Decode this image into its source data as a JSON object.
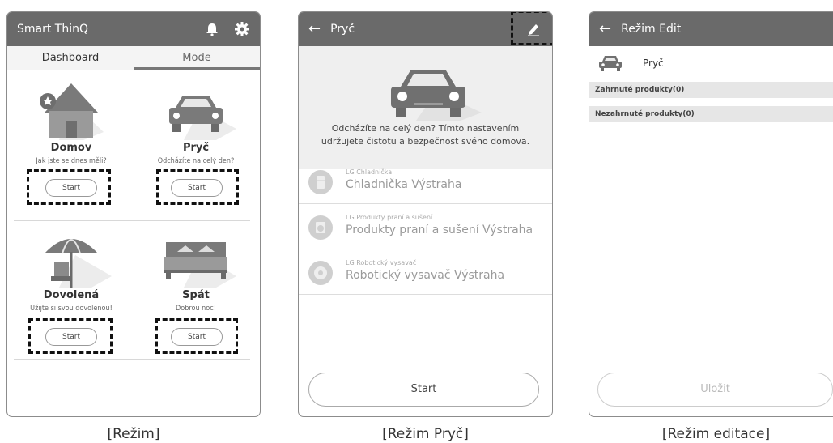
{
  "panel1": {
    "app_title": "Smart ThinQ",
    "tabs": [
      "Dashboard",
      "Mode"
    ],
    "cards": [
      {
        "name": "Domov",
        "subtitle": "Jak jste se dnes měli?",
        "button": "Start"
      },
      {
        "name": "Pryč",
        "subtitle": "Odcházíte na celý den?",
        "button": "Start"
      },
      {
        "name": "Dovolená",
        "subtitle": "Užijte si svou dovolenou!",
        "button": "Start"
      },
      {
        "name": "Spát",
        "subtitle": "Dobrou noc!",
        "button": "Start"
      }
    ],
    "caption": "[Režim]"
  },
  "panel2": {
    "title": "Pryč",
    "description_line1": "Odcházíte na celý den? Tímto nastavením",
    "description_line2": "udržujete čistotu a bezpečnost svého domova.",
    "products": [
      {
        "category": "LG Chladnička",
        "name": "Chladnička Výstraha",
        "icon": "fridge-icon"
      },
      {
        "category": "LG Produkty praní a sušení",
        "name": "Produkty praní a sušení Výstraha",
        "icon": "washer-icon"
      },
      {
        "category": "LG Robotický vysavač",
        "name": "Robotický vysavač Výstraha",
        "icon": "robot-vacuum-icon"
      }
    ],
    "start_button": "Start",
    "caption": "[Režim Pryč]"
  },
  "panel3": {
    "title": "Režim Edit",
    "mode_name": "Pryč",
    "included": "Zahrnuté produkty(0)",
    "excluded": "Nezahrnuté produkty(0)",
    "save_button": "Uložit",
    "caption": "[Režim editace]"
  },
  "colors": {
    "appbar": "#6a6a6a",
    "hero_bg": "#efefef",
    "section_bg": "#e6e6e6",
    "highlight_border": "#111111"
  }
}
